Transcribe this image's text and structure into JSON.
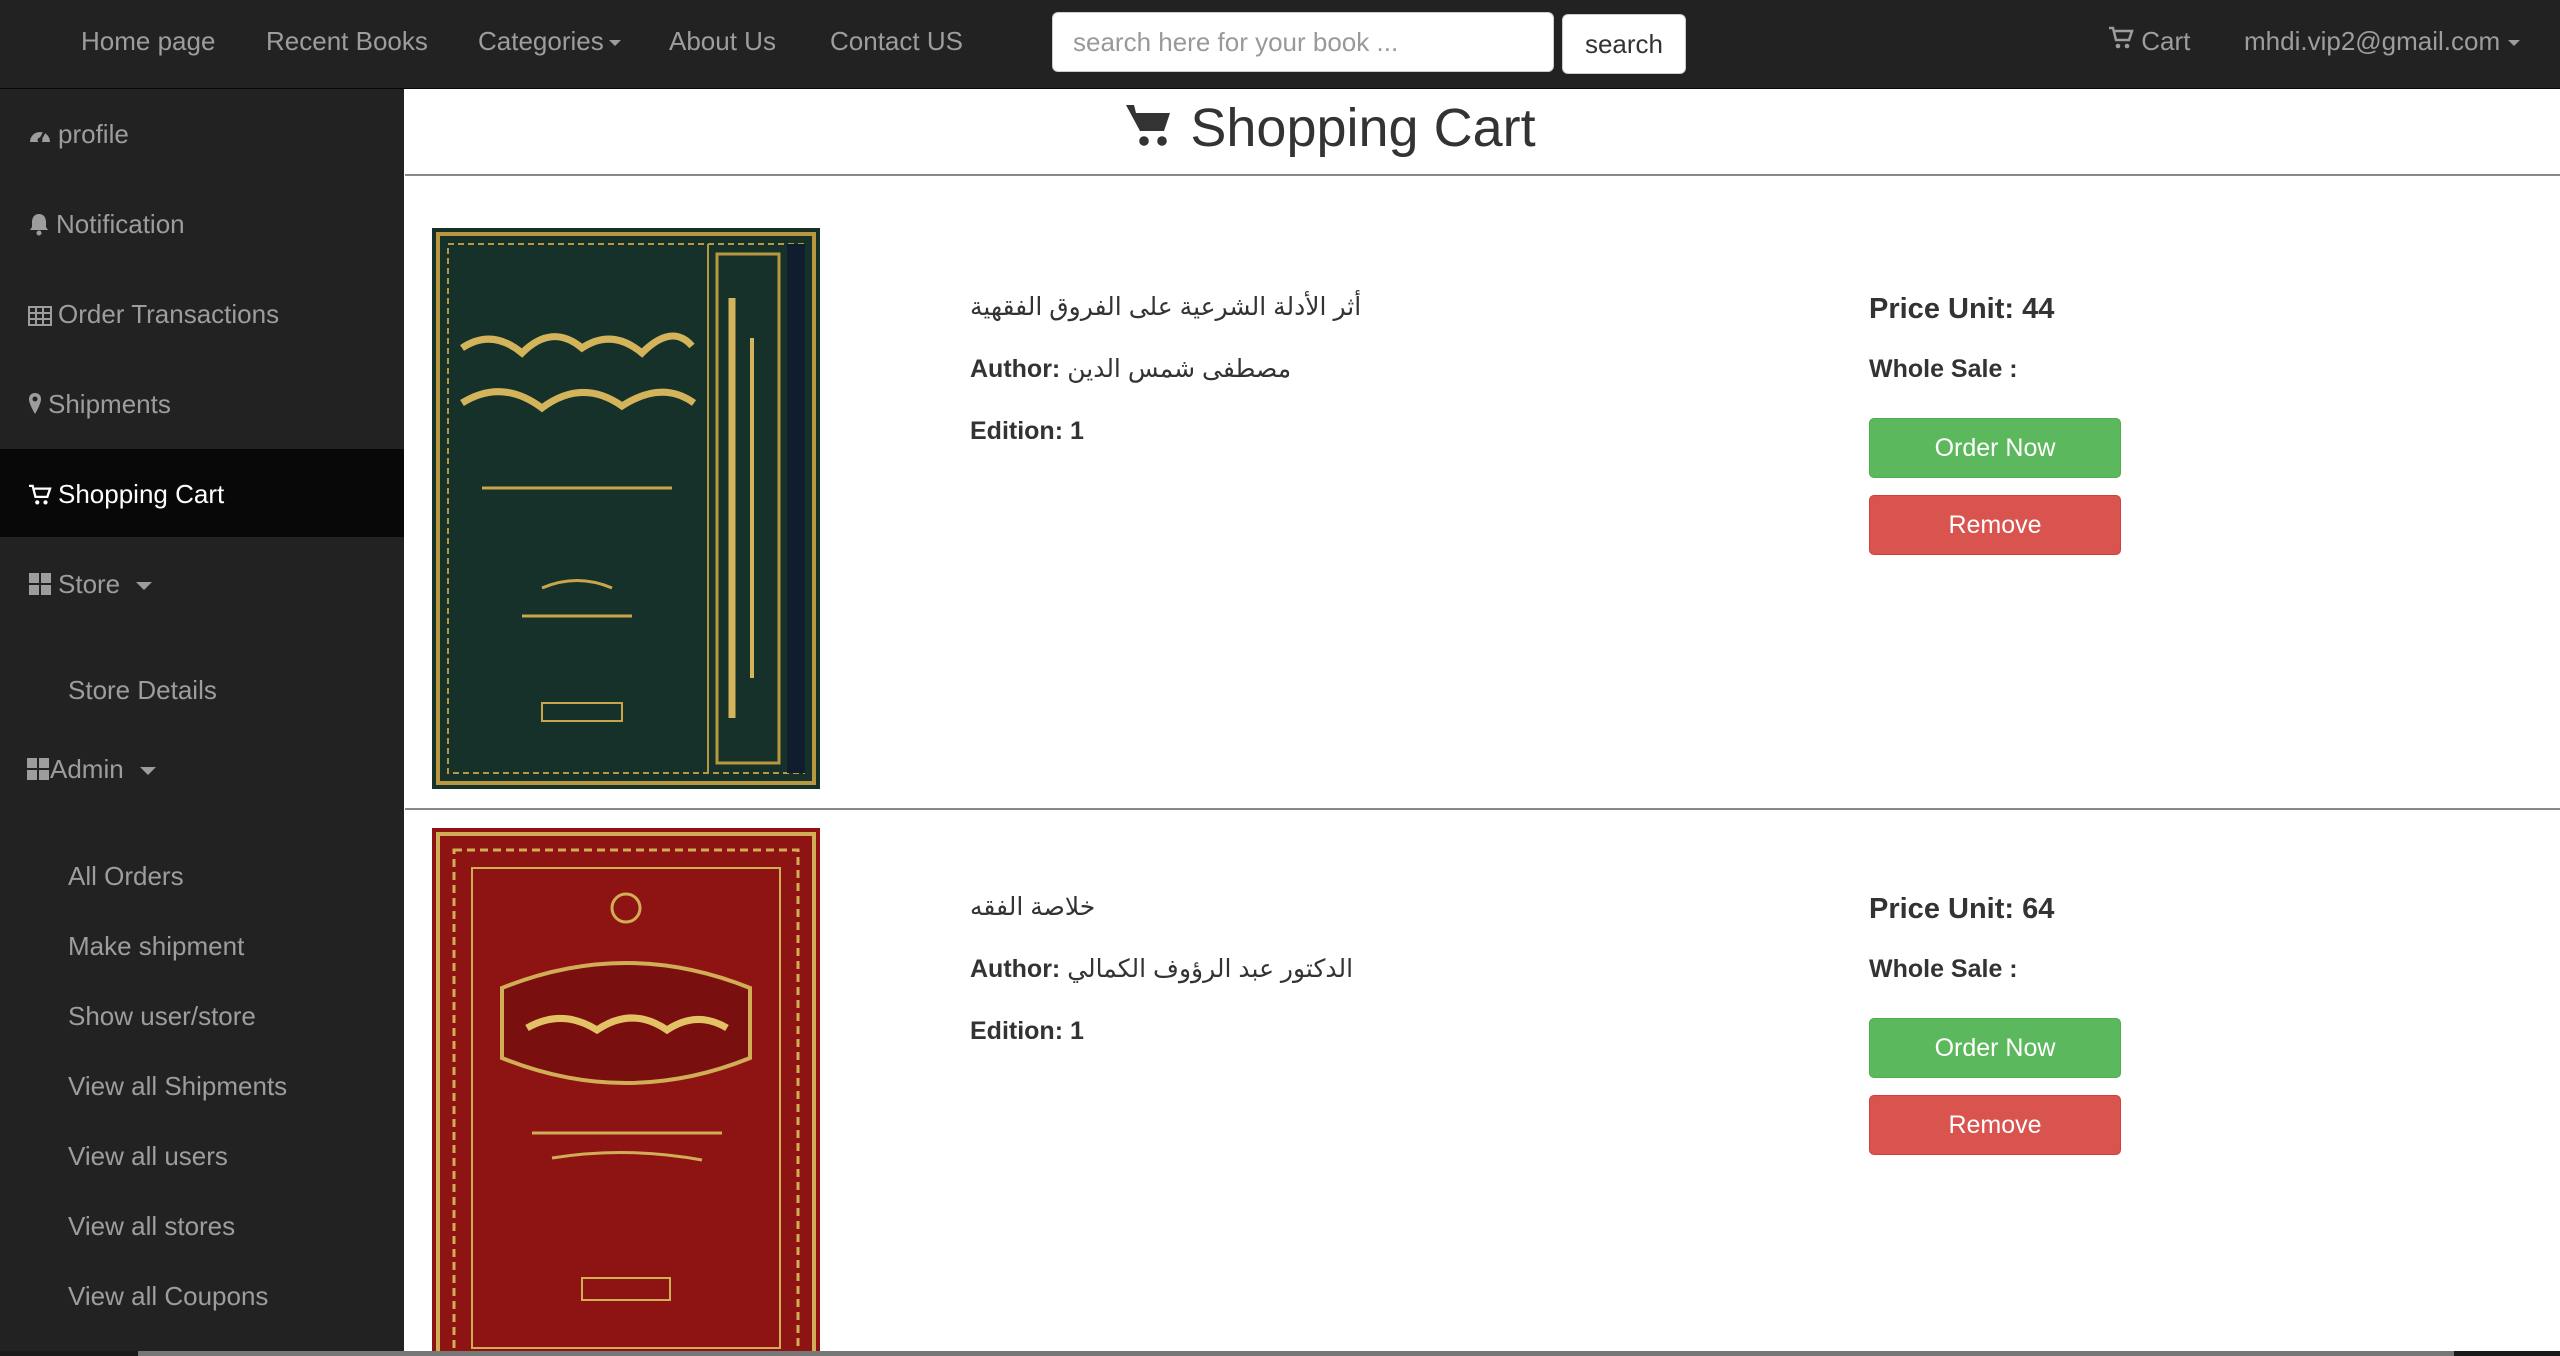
{
  "nav": {
    "links": [
      "Home page",
      "Recent Books",
      "Categories",
      "About Us",
      "Contact US"
    ],
    "search_placeholder": "search here for your book ...",
    "search_button": "search",
    "cart": "Cart",
    "user": "mhdi.vip2@gmail.com"
  },
  "sidebar": {
    "items": [
      "profile",
      "Notification",
      "Order Transactions",
      "Shipments",
      "Shopping Cart",
      "Store"
    ],
    "store_sub": [
      "Store Details"
    ],
    "admin_label": "Admin",
    "admin_sub": [
      "All Orders",
      "Make shipment",
      "Show user/store",
      "View all Shipments",
      "View all users",
      "View all stores",
      "View all Coupons"
    ]
  },
  "page": {
    "title": "Shopping Cart"
  },
  "labels": {
    "author": "Author:",
    "edition": "Edition:",
    "price_unit": "Price Unit:",
    "whole_sale": "Whole Sale :",
    "order_now": "Order Now",
    "remove": "Remove"
  },
  "books": [
    {
      "title": "أثر الأدلة الشرعية على الفروق الفقهية",
      "author": "مصطفى شمس الدين",
      "edition": "1",
      "price": "44",
      "cover_color": "#16302a"
    },
    {
      "title": "خلاصة الفقه",
      "author": "الدكتور عبد الرؤوف الكمالي",
      "edition": "1",
      "price": "64",
      "cover_color": "#8e1414"
    }
  ]
}
